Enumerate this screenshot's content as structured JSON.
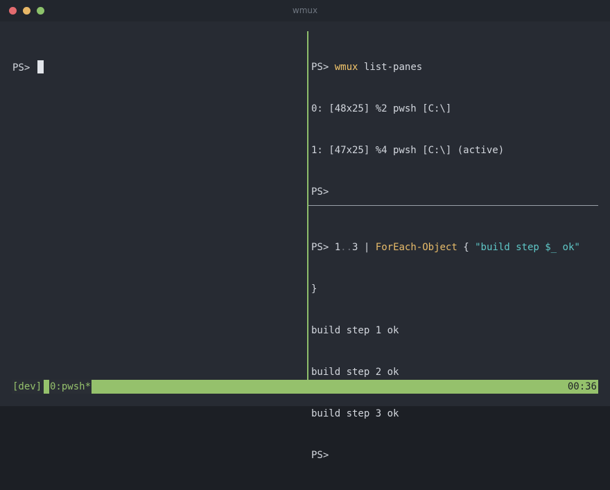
{
  "window": {
    "title": "wmux"
  },
  "panes": {
    "left": {
      "prompt": "PS>"
    },
    "top_right": {
      "lines": [
        {
          "prompt": "PS>",
          "command": "wmux",
          "args": "list-panes"
        },
        {
          "text": "0: [48x25] %2 pwsh [C:\\]"
        },
        {
          "text": "1: [47x25] %4 pwsh [C:\\] (active)"
        },
        {
          "prompt": "PS>"
        }
      ]
    },
    "bottom_right": {
      "command": {
        "prompt": "PS>",
        "range_start": "1",
        "range_op": "..",
        "range_end": "3",
        "pipe": "|",
        "cmdlet": "ForEach-Object",
        "brace_open": "{",
        "string": "\"build step $_ ok\"",
        "brace_close": "}"
      },
      "output": [
        "build step 1 ok",
        "build step 2 ok",
        "build step 3 ok"
      ],
      "final_prompt": "PS>"
    }
  },
  "status_bar": {
    "session": "[dev]",
    "window": "0:pwsh*",
    "clock": "00:36"
  },
  "colors": {
    "accent": "#95c16c",
    "background": "#272b33",
    "command": "#f2c56b",
    "string": "#5fc7c7"
  }
}
